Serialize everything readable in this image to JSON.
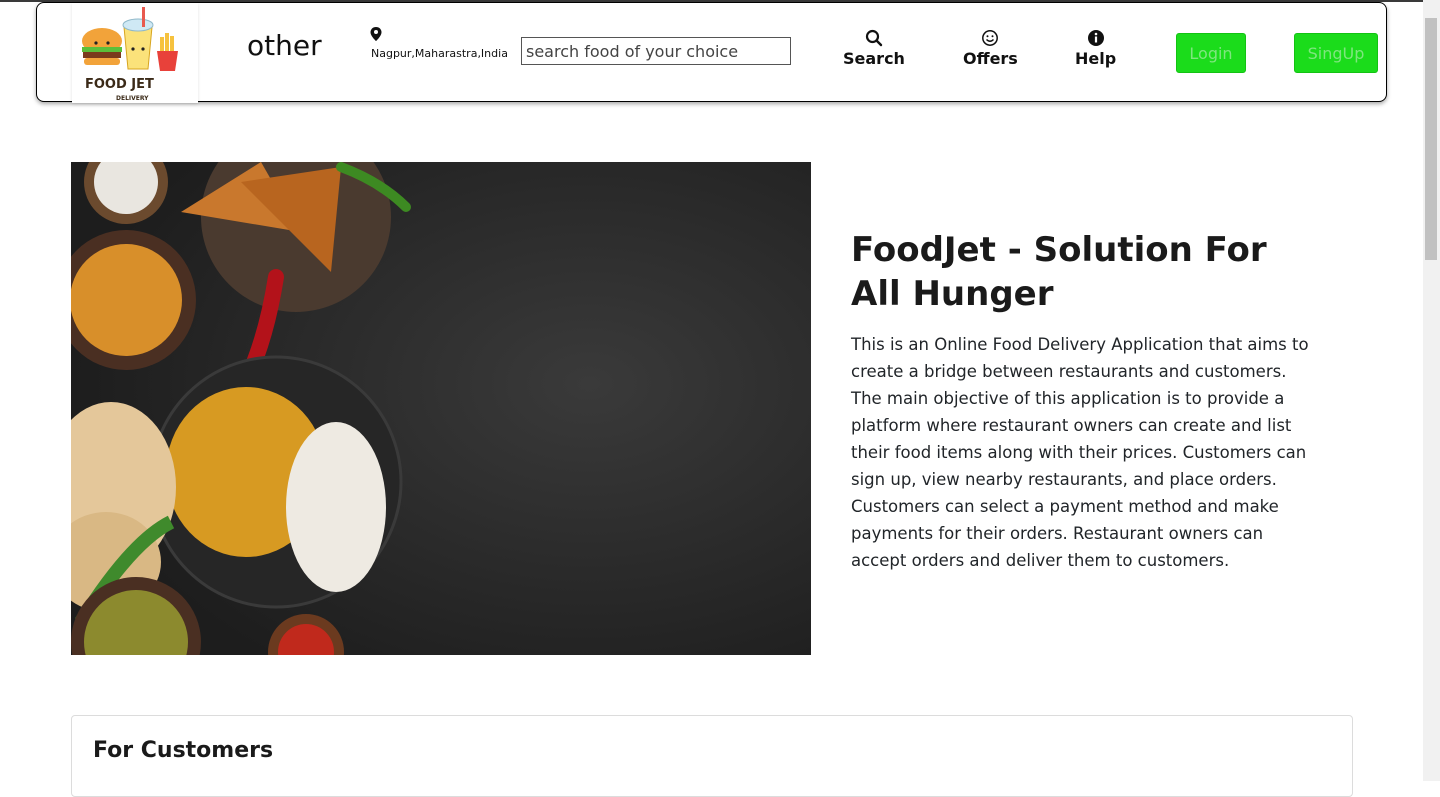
{
  "header": {
    "brand_text": "other",
    "logo_text_line1": "FOOD JET",
    "logo_text_line2": "DELIVERY",
    "location": "Nagpur,Maharastra,India",
    "search_placeholder": "search food of your choice",
    "nav": [
      {
        "label": "Search",
        "icon": "search-icon"
      },
      {
        "label": "Offers",
        "icon": "smiley-icon"
      },
      {
        "label": "Help",
        "icon": "info-icon"
      }
    ],
    "login_label": "Login",
    "signup_label": "SingUp"
  },
  "hero": {
    "title": "FoodJet - Solution For All Hunger",
    "description": "This is an Online Food Delivery Application that aims to create a bridge between restaurants and customers. The main objective of this application is to provide a platform where restaurant owners can create and list their food items along with their prices. Customers can sign up, view nearby restaurants, and place orders. Customers can select a payment method and make payments for their orders. Restaurant owners can accept orders and deliver them to customers."
  },
  "sections": {
    "customers_title": "For Customers"
  },
  "colors": {
    "button_green": "#1bdc1b",
    "button_text": "#7fe67f"
  }
}
